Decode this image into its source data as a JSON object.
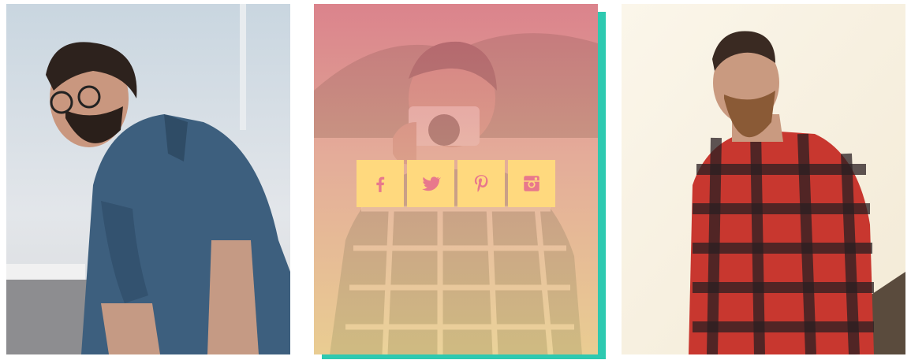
{
  "gallery": {
    "cards": [
      {
        "subject": "bearded-man-glasses-denim-shirt"
      },
      {
        "subject": "photographer-with-camera-plaid-shirt",
        "hover": true
      },
      {
        "subject": "bearded-man-red-plaid-shirt"
      }
    ],
    "social_icons": [
      "facebook-icon",
      "twitter-icon",
      "pinterest-icon",
      "instagram-icon"
    ],
    "colors": {
      "accent_shadow": "#2ec9b0",
      "icon_bg": "#ffd97e",
      "icon_fg": "#e8788c",
      "overlay_top": "#e8788c",
      "overlay_bottom": "#f6d68c"
    }
  }
}
